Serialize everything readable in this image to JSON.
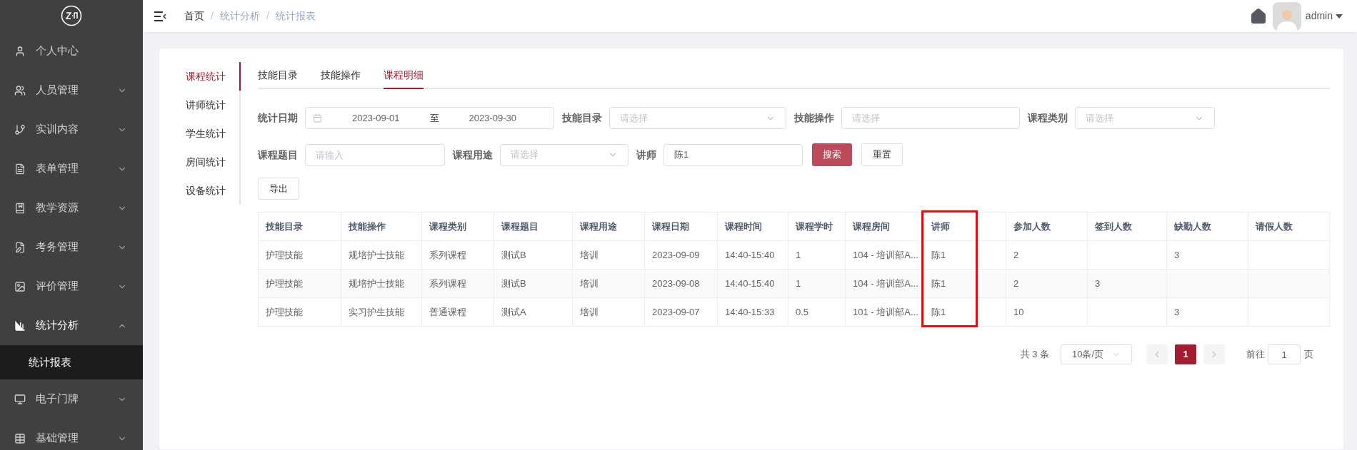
{
  "sidebar": {
    "items": [
      {
        "label": "个人中心",
        "has_children": false,
        "expanded": false
      },
      {
        "label": "人员管理",
        "has_children": true,
        "expanded": false
      },
      {
        "label": "实训内容",
        "has_children": true,
        "expanded": false
      },
      {
        "label": "表单管理",
        "has_children": true,
        "expanded": false
      },
      {
        "label": "教学资源",
        "has_children": true,
        "expanded": false
      },
      {
        "label": "考务管理",
        "has_children": true,
        "expanded": false
      },
      {
        "label": "评价管理",
        "has_children": true,
        "expanded": false
      },
      {
        "label": "统计分析",
        "has_children": true,
        "expanded": true,
        "children": [
          {
            "label": "统计报表",
            "selected": true
          }
        ]
      },
      {
        "label": "电子门牌",
        "has_children": true,
        "expanded": false
      },
      {
        "label": "基础管理",
        "has_children": true,
        "expanded": false
      }
    ]
  },
  "header": {
    "breadcrumb": [
      {
        "label": "首页",
        "is_link": true
      },
      {
        "label": "统计分析",
        "is_link": false
      },
      {
        "label": "统计报表",
        "is_link": false
      }
    ],
    "separator": "/",
    "user": "admin"
  },
  "side_tabs": [
    {
      "label": "课程统计",
      "selected": true
    },
    {
      "label": "讲师统计",
      "selected": false
    },
    {
      "label": "学生统计",
      "selected": false
    },
    {
      "label": "房间统计",
      "selected": false
    },
    {
      "label": "设备统计",
      "selected": false
    }
  ],
  "tabs": [
    {
      "label": "技能目录",
      "selected": false
    },
    {
      "label": "技能操作",
      "selected": false
    },
    {
      "label": "课程明细",
      "selected": true
    }
  ],
  "filter_rows": [
    [
      {
        "kind": "daterange",
        "label": "统计日期",
        "start": "2023-09-01",
        "separator": "至",
        "end": "2023-09-30"
      },
      {
        "kind": "select",
        "label": "技能目录",
        "placeholder": "请选择"
      },
      {
        "kind": "input",
        "label": "技能操作",
        "placeholder": "请选择"
      },
      {
        "kind": "select",
        "label": "课程类别",
        "placeholder": "请选择"
      }
    ],
    [
      {
        "kind": "input",
        "label": "课程题目",
        "placeholder": "请输入"
      },
      {
        "kind": "select",
        "label": "课程用途",
        "placeholder": "请选择"
      },
      {
        "kind": "input",
        "label": "讲师",
        "value": "陈1"
      }
    ]
  ],
  "actions": [
    {
      "label": "搜索",
      "kind": "primary"
    },
    {
      "label": "重置",
      "kind": "default"
    }
  ],
  "export_button": "导出",
  "table": {
    "columns": [
      {
        "label": "技能目录",
        "highlighted": false
      },
      {
        "label": "技能操作",
        "highlighted": false
      },
      {
        "label": "课程类别",
        "highlighted": false
      },
      {
        "label": "课程题目",
        "highlighted": false
      },
      {
        "label": "课程用途",
        "highlighted": false
      },
      {
        "label": "课程日期",
        "highlighted": false
      },
      {
        "label": "课程时间",
        "highlighted": false
      },
      {
        "label": "课程学时",
        "highlighted": false
      },
      {
        "label": "课程房间",
        "highlighted": false
      },
      {
        "label": "讲师",
        "highlighted": true
      },
      {
        "label": "参加人数",
        "highlighted": false
      },
      {
        "label": "签到人数",
        "highlighted": false
      },
      {
        "label": "缺勤人数",
        "highlighted": false
      },
      {
        "label": "请假人数",
        "highlighted": false
      }
    ],
    "rows": [
      [
        "护理技能",
        "规培护士技能",
        "系列课程",
        "测试B",
        "培训",
        "2023-09-09",
        "14:40-15:40",
        "1",
        "104 - 培训部A...",
        "陈1",
        "2",
        null,
        "3",
        null
      ],
      [
        "护理技能",
        "规培护士技能",
        "系列课程",
        "测试B",
        "培训",
        "2023-09-08",
        "14:40-15:40",
        "1",
        "104 - 培训部A...",
        "陈1",
        "2",
        "3",
        null,
        null
      ],
      [
        "护理技能",
        "实习护生技能",
        "普通课程",
        "测试A",
        "培训",
        "2023-09-07",
        "14:40-15:33",
        "0.5",
        "101 - 培训部A...",
        "陈1",
        "10",
        null,
        "3",
        null
      ]
    ]
  },
  "pagination": {
    "total": "共 3 条",
    "page_size": "10条/页",
    "pages": [
      {
        "label": "1",
        "selected": true
      }
    ],
    "goto_label": "前往",
    "goto_value": "1",
    "goto_suffix": "页"
  }
}
